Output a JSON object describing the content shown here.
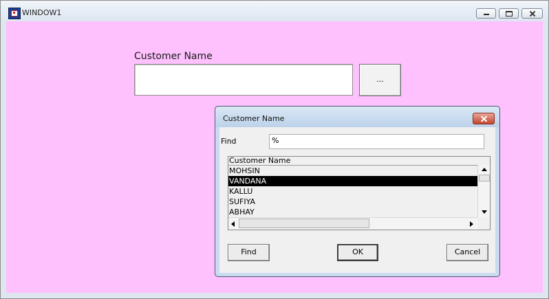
{
  "window": {
    "title": "WINDOW1",
    "controls": [
      "minimize-icon",
      "maximize-icon",
      "close-icon"
    ]
  },
  "form": {
    "customer_label": "Customer Name",
    "customer_value": "",
    "lookup_button": "..."
  },
  "dialog": {
    "title": "Customer Name",
    "find_label": "Find",
    "find_value": "%",
    "list": {
      "header": "Customer Name",
      "rows": [
        "MOHSIN",
        "VANDANA",
        "KALLU",
        "SUFIYA",
        "ABHAY"
      ],
      "selected_index": 1
    },
    "buttons": {
      "find": "Find",
      "ok": "OK",
      "cancel": "Cancel"
    }
  },
  "colors": {
    "client_background": "#fec1fe",
    "dialog_frame": "#c9dbef",
    "selection": "#000000",
    "close_button": "#c2452e"
  }
}
